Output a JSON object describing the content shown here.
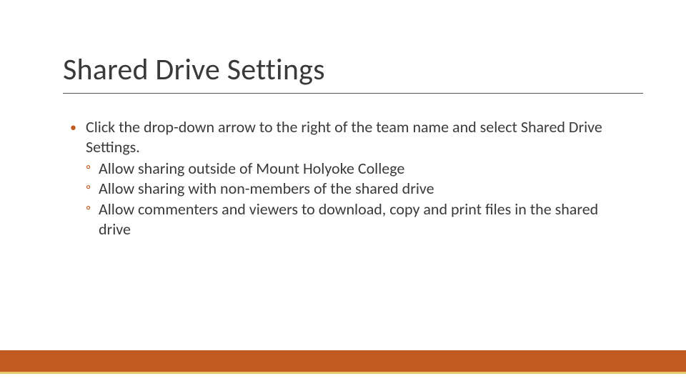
{
  "slide": {
    "title": "Shared Drive Settings",
    "bullets": [
      {
        "text": "Click the drop-down arrow to the right of the team name and select Shared Drive Settings.",
        "sub": [
          "Allow sharing outside of Mount Holyoke College",
          "Allow sharing with non-members of the shared drive",
          "Allow commenters and viewers to download, copy and print files in the shared drive"
        ]
      }
    ]
  },
  "theme": {
    "accent": "#c15a1f",
    "accent2": "#e6c76a"
  }
}
